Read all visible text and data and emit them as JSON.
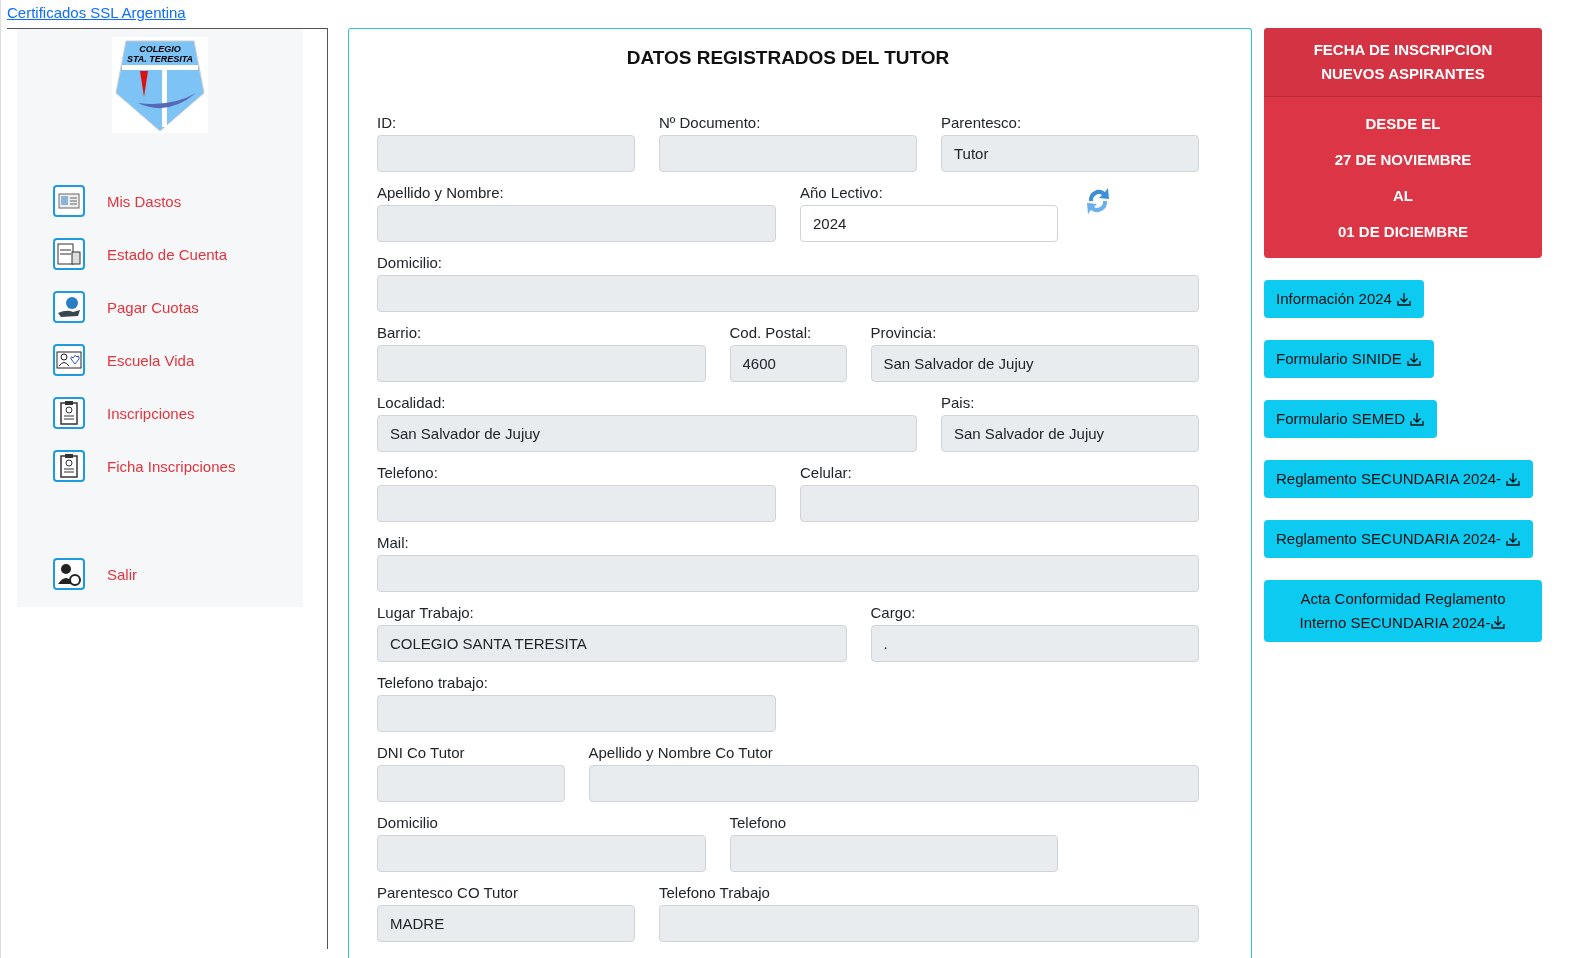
{
  "top_link": "Certificados SSL Argentina",
  "sidebar": {
    "logo_text": [
      "COLEGIO",
      "STA. TERESITA"
    ],
    "items": [
      {
        "label": "Mis Dastos",
        "kind": "id-card"
      },
      {
        "label": "Estado de Cuenta",
        "kind": "statement"
      },
      {
        "label": "Pagar Cuotas",
        "kind": "payment"
      },
      {
        "label": "Escuela Vida",
        "kind": "people"
      },
      {
        "label": "Inscripciones",
        "kind": "clipboard"
      },
      {
        "label": "Ficha Inscripciones",
        "kind": "clipboard"
      },
      {
        "label": "Salir",
        "kind": "logout"
      }
    ]
  },
  "form": {
    "title": "DATOS REGISTRADOS DEL TUTOR",
    "rows": [
      [
        {
          "label": "ID:",
          "readonly": true
        },
        {
          "label": "Nº Documento:",
          "readonly": true
        },
        {
          "label": "Parentesco:",
          "value": "Tutor",
          "readonly": true
        }
      ],
      [
        {
          "label": "Apellido y Nombre:",
          "readonly": true
        },
        {
          "label": "Año Lectivo:",
          "value": "2024",
          "readonly": false
        }
      ],
      [
        {
          "label": "Domicilio:",
          "readonly": true
        }
      ],
      [
        {
          "label": "Barrio:",
          "readonly": true
        },
        {
          "label": "Cod. Postal:",
          "value": "4600",
          "readonly": true
        },
        {
          "label": "Provincia:",
          "value": "San Salvador de Jujuy",
          "readonly": true
        }
      ],
      [
        {
          "label": "Localidad:",
          "value": "San Salvador de Jujuy",
          "readonly": true
        },
        {
          "label": "Pais:",
          "value": "San Salvador de Jujuy",
          "readonly": true
        }
      ],
      [
        {
          "label": "Telefono:",
          "readonly": true
        },
        {
          "label": "Celular:",
          "readonly": true
        }
      ],
      [
        {
          "label": "Mail:",
          "readonly": true
        }
      ],
      [
        {
          "label": "Lugar Trabajo:",
          "value": "COLEGIO SANTA TERESITA",
          "readonly": true
        },
        {
          "label": "Cargo:",
          "value": ".",
          "readonly": true
        }
      ],
      [
        {
          "label": "Telefono trabajo:",
          "readonly": true
        }
      ],
      [
        {
          "label": "DNI Co Tutor",
          "readonly": true
        },
        {
          "label": "Apellido y Nombre Co Tutor",
          "readonly": true
        }
      ],
      [
        {
          "label": "Domicilio",
          "readonly": true
        },
        {
          "label": "Telefono",
          "readonly": true
        }
      ],
      [
        {
          "label": "Parentesco CO Tutor",
          "value": "MADRE",
          "readonly": true
        },
        {
          "label": "Telefono Trabajo",
          "readonly": true
        }
      ]
    ]
  },
  "notice": {
    "title": [
      "FECHA DE INSCRIPCION",
      "NUEVOS ASPIRANTES"
    ],
    "lines": [
      "DESDE EL",
      "27 DE NOVIEMBRE",
      "AL",
      "01 DE DICIEMBRE"
    ]
  },
  "downloads": [
    "Información 2024",
    "Formulario SINIDE",
    "Formulario SEMED",
    "Reglamento SECUNDARIA 2024-",
    "Reglamento SECUNDARIA 2024-",
    "Acta Conformidad Reglamento Interno SECUNDARIA 2024-"
  ]
}
